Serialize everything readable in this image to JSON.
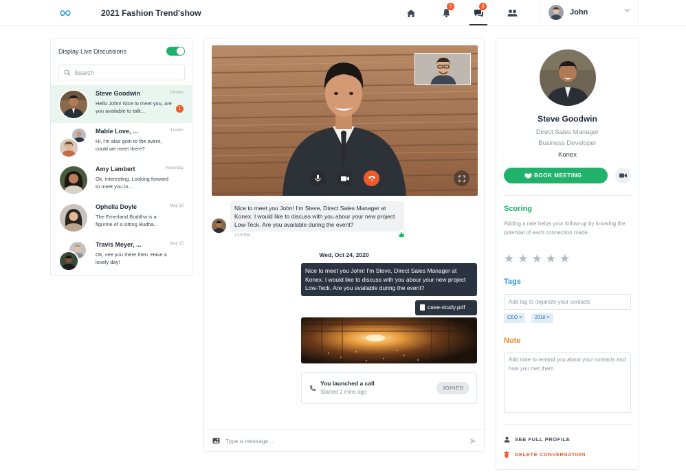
{
  "app": {
    "title": "2021 Fashion Trend'show",
    "nav": {
      "notifications_count": "5",
      "messages_count": "3"
    },
    "user": {
      "name": "John"
    }
  },
  "colors": {
    "brand_green": "#20b26b",
    "accent_orange": "#ef5a2a",
    "accent_blue": "#2a9bd6",
    "dark_bubble": "#2b3340"
  },
  "sidebar": {
    "toggle_label": "Display Live Discussions",
    "toggle_on": true,
    "search_placeholder": "Search",
    "conversations": [
      {
        "name": "Steve Goodwin",
        "time": "2 hours",
        "preview": "Hello John! Nice to meet you, are you available to talk...",
        "unread": "1",
        "active": true
      },
      {
        "name": "Mable Love, ...",
        "time": "3 hours",
        "preview": "Hi, i'm also goin to the event, could we meet there?"
      },
      {
        "name": "Amy Lambert",
        "time": "Yesterday",
        "preview": "Ok, interesting. Looking forward to meet you to..."
      },
      {
        "name": "Ophelia Doyle",
        "time": "May 18",
        "preview": "The Emerland Buddha is a figurine of a sitting Budha..."
      },
      {
        "name": "Travis Meyer, ...",
        "time": "May 15",
        "preview": "Ok, see you there then. Have a lovely day!"
      }
    ]
  },
  "chat": {
    "incoming_message": "Nice to meet you John! I'm Steve, Direct Sales Manager at Konex. I would like to discuss with you abour your new project Low-Teck. Are you available during the event?",
    "incoming_time": "2:15 PM",
    "date_separator": "Wed, Oct 24, 2020",
    "outgoing_message": "Nice to meet you John! I'm Steve, Direct Sales Manager at Konex. I would like to discuss with you abour your new project Low-Teck. Are you available during the event?",
    "attachment_name": "case-study.pdf",
    "call": {
      "title": "You launched a call",
      "subtitle": "Started 2 mins ago",
      "status": "JOINED"
    },
    "composer_placeholder": "Type a message..."
  },
  "profile": {
    "name": "Steve Goodwin",
    "role": "Direct Sales Manager",
    "role2": "Business Developer",
    "company": "Konex",
    "book_button": "BOOK MEETING",
    "scoring": {
      "title": "Scoring",
      "description": "Adding a rate helps your follow-up by knowing the potential of each connection made.",
      "rating": 0,
      "max": 5
    },
    "tags": {
      "title": "Tags",
      "placeholder": "Add tag to organize your contacts",
      "items": [
        "CEO ×",
        "2018 ×"
      ]
    },
    "note": {
      "title": "Note",
      "placeholder": "Add note to remind you about your contacts and how you met them"
    },
    "see_full_profile": "SEE FULL PROFILE",
    "delete_conversation": "DELETE CONVERSATION"
  }
}
